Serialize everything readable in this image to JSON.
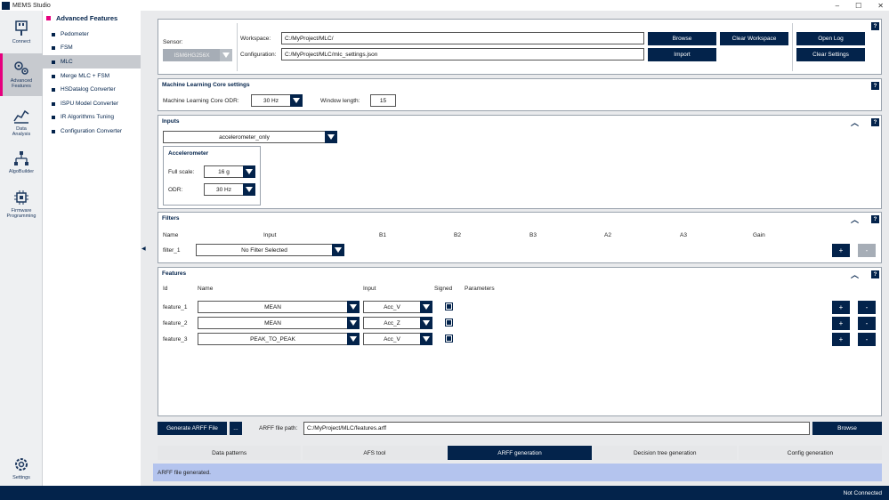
{
  "window": {
    "title": "MEMS Studio",
    "controls": [
      "–",
      "☐",
      "✕"
    ]
  },
  "nav": {
    "items": [
      {
        "label": "Connect",
        "icon": "usb-icon"
      },
      {
        "label": "Advanced\nFeatures",
        "icon": "gears-icon"
      },
      {
        "label": "Data\nAnalysis",
        "icon": "chart-icon"
      },
      {
        "label": "AlgoBuilder",
        "icon": "flow-icon"
      },
      {
        "label": "Firmware\nProgramming",
        "icon": "chip-icon"
      },
      {
        "label": "Settings",
        "icon": "gear-icon"
      }
    ]
  },
  "subnav": {
    "header": "Advanced Features",
    "items": [
      "Pedometer",
      "FSM",
      "MLC",
      "Merge MLC + FSM",
      "HSDatalog Converter",
      "ISPU Model Converter",
      "IR Algorithms Tuning",
      "Configuration Converter"
    ],
    "collapse_glyph": "◀"
  },
  "top": {
    "sensor_label": "Sensor:",
    "sensor_value": "ISM6HG256X",
    "workspace_label": "Workspace:",
    "workspace_value": "C:/MyProject/MLC/",
    "configuration_label": "Configuration:",
    "configuration_value": "C:/MyProject/MLC/mlc_settings.json",
    "browse": "Browse",
    "clear_workspace": "Clear Workspace",
    "import": "Import",
    "open_log": "Open Log",
    "clear_settings": "Clear Settings",
    "help": "?"
  },
  "mlc_settings": {
    "title": "Machine Learning Core settings",
    "odr_label": "Machine Learning Core ODR:",
    "odr_value": "30 Hz",
    "window_label": "Window length:",
    "window_value": "15",
    "help": "?"
  },
  "inputs": {
    "title": "Inputs",
    "input_value": "accelerometer_only",
    "accel_title": "Accelerometer",
    "full_scale_label": "Full scale:",
    "full_scale_value": "16 g",
    "odr_label": "ODR:",
    "odr_value": "30 Hz",
    "help": "?",
    "collapse": "︿"
  },
  "filters": {
    "title": "Filters",
    "headers": [
      "Name",
      "Input",
      "B1",
      "B2",
      "B3",
      "A2",
      "A3",
      "Gain"
    ],
    "rows": [
      {
        "name": "filter_1",
        "input": "No Filter Selected"
      }
    ],
    "add": "+",
    "remove": "-",
    "help": "?",
    "collapse": "︿"
  },
  "features": {
    "title": "Features",
    "headers": {
      "id": "Id",
      "name": "Name",
      "input": "Input",
      "signed": "Signed",
      "parameters": "Parameters"
    },
    "rows": [
      {
        "id": "feature_1",
        "name": "MEAN",
        "input": "Acc_V",
        "signed": true
      },
      {
        "id": "feature_2",
        "name": "MEAN",
        "input": "Acc_Z",
        "signed": true
      },
      {
        "id": "feature_3",
        "name": "PEAK_TO_PEAK",
        "input": "Acc_V",
        "signed": true
      }
    ],
    "add": "+",
    "remove": "-",
    "help": "?",
    "collapse": "︿"
  },
  "arff": {
    "generate": "Generate ARFF File",
    "more": "...",
    "path_label": "ARFF file path:",
    "path_value": "C:/MyProject/MLC/features.arff",
    "browse": "Browse"
  },
  "tabs": [
    "Data patterns",
    "AFS tool",
    "ARFF generation",
    "Decision tree generation",
    "Config generation"
  ],
  "active_tab": "ARFF generation",
  "status_message": "ARFF file generated.",
  "connection_status": "Not Connected",
  "colors": {
    "primary": "#03234b",
    "accent": "#e6007e",
    "status_bg": "#b4c4ee",
    "disabled": "#a6adb6"
  }
}
